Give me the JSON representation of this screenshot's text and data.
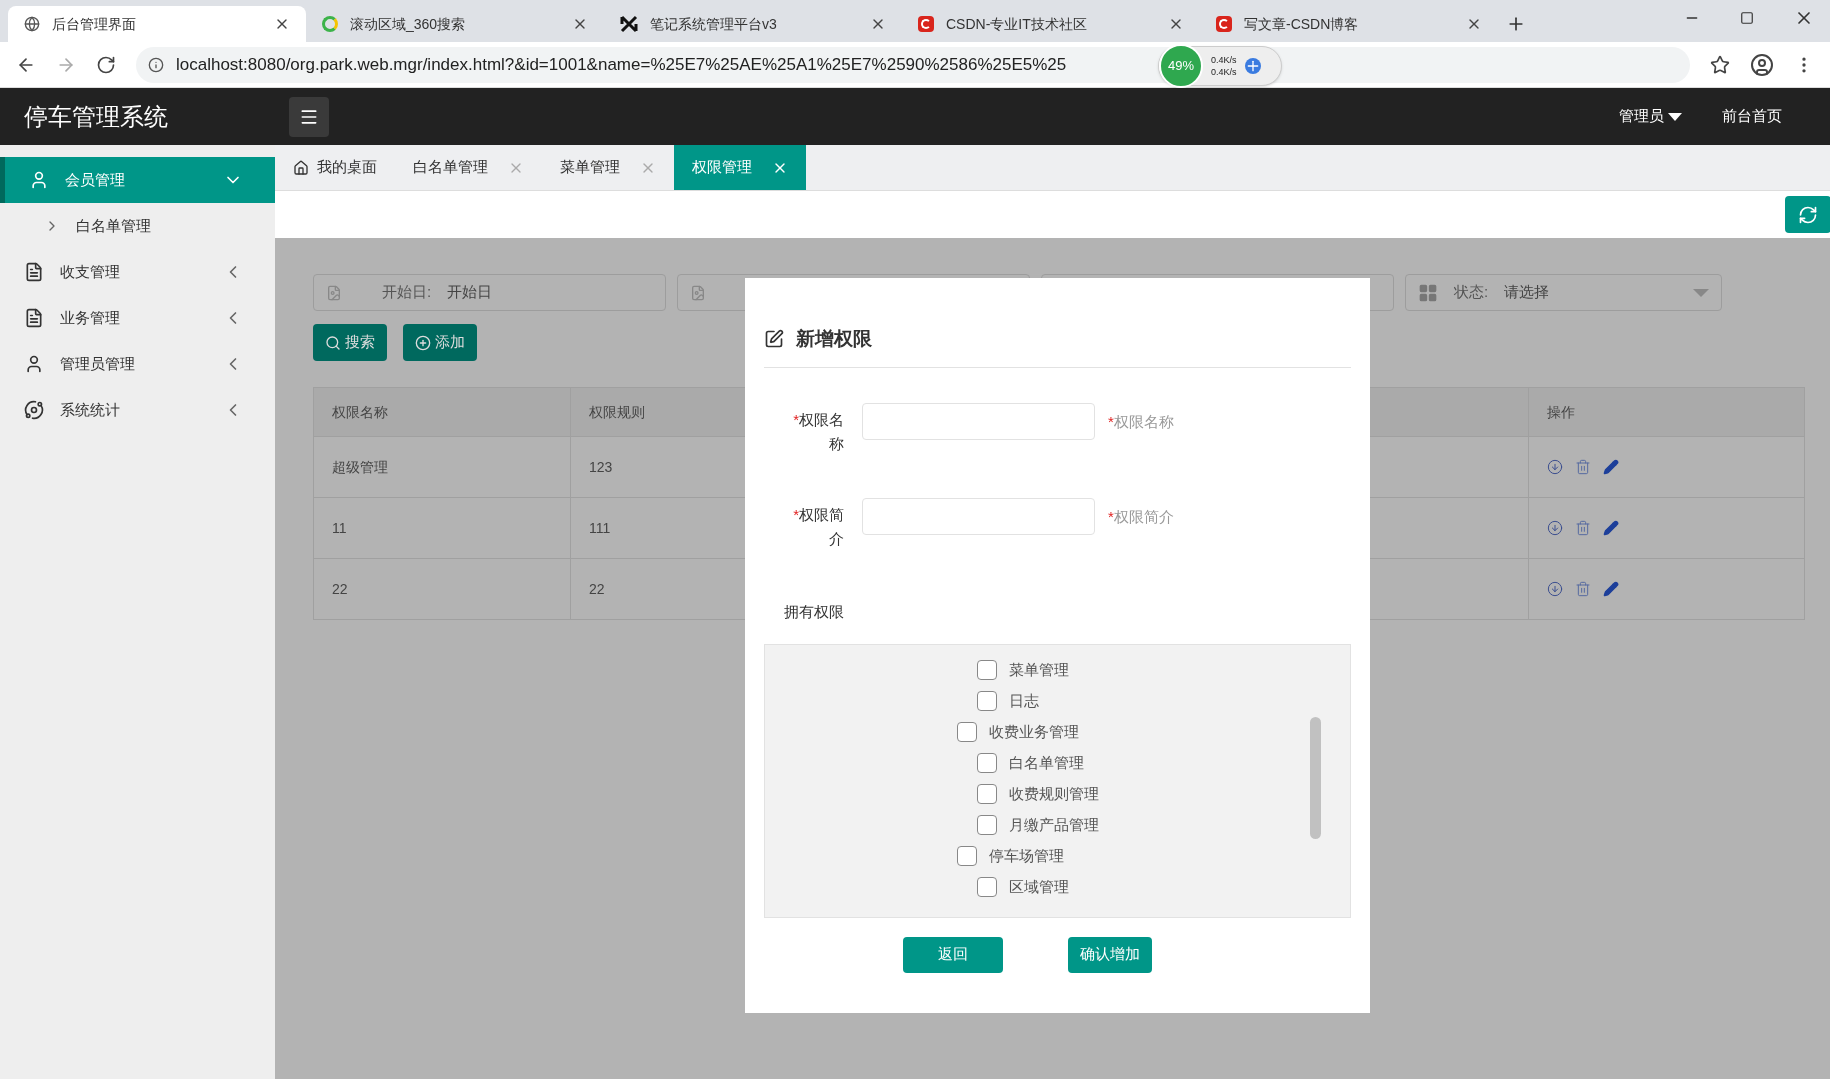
{
  "browser": {
    "tabs": [
      {
        "title": "后台管理界面",
        "selected": true
      },
      {
        "title": "滚动区域_360搜索",
        "selected": false
      },
      {
        "title": "笔记系统管理平台v3",
        "selected": false
      },
      {
        "title": "CSDN-专业IT技术社区",
        "selected": false
      },
      {
        "title": "写文章-CSDN博客",
        "selected": false
      }
    ],
    "url": "localhost:8080/org.park.web.mgr/index.html?&id=1001&name=%25E7%25AE%25A1%25E7%2590%2586%25E5%25",
    "speed": {
      "percent": "49%",
      "up": "0.4K/s",
      "down": "0.4K/s"
    }
  },
  "header": {
    "title": "停车管理系统",
    "user_menu": "管理员",
    "home_link": "前台首页"
  },
  "sidebar": {
    "items": [
      {
        "label": "会员管理",
        "selected": true,
        "expanded": true,
        "children": [
          {
            "label": "白名单管理"
          }
        ]
      },
      {
        "label": "收支管理",
        "selected": false,
        "expanded": false
      },
      {
        "label": "业务管理",
        "selected": false,
        "expanded": false
      },
      {
        "label": "管理员管理",
        "selected": false,
        "expanded": false
      },
      {
        "label": "系统统计",
        "selected": false,
        "expanded": false
      }
    ]
  },
  "page_tabs": [
    {
      "label": "我的桌面",
      "selected": false,
      "closable": false
    },
    {
      "label": "白名单管理",
      "selected": false,
      "closable": true
    },
    {
      "label": "菜单管理",
      "selected": false,
      "closable": true
    },
    {
      "label": "权限管理",
      "selected": true,
      "closable": true
    }
  ],
  "filters": [
    {
      "kind": "date",
      "label": "开始日:",
      "value": "开始日"
    },
    {
      "kind": "date"
    },
    {
      "kind": "text"
    },
    {
      "kind": "select",
      "label": "状态:",
      "value": "请选择"
    }
  ],
  "actions": [
    "搜索",
    "添加"
  ],
  "table": {
    "columns": [
      "权限名称",
      "权限规则",
      "",
      "操作"
    ],
    "rows": [
      [
        "超级管理",
        "123"
      ],
      [
        "11",
        "111"
      ],
      [
        "22",
        "22"
      ]
    ]
  },
  "dialog": {
    "title": "新增权限",
    "fields": [
      {
        "label": "权限名称",
        "hint": "权限名称",
        "mark": "*",
        "hint_mark": "*"
      },
      {
        "label": "权限简介",
        "hint": "权限简介",
        "mark": "*",
        "hint_mark": "*"
      }
    ],
    "permissions_label": "拥有权限",
    "permissions": [
      {
        "children": [
          {
            "label": "菜单管理",
            "checked": false
          },
          {
            "label": "日志",
            "checked": false
          }
        ]
      },
      {
        "label": "收费业务管理",
        "checked": false,
        "children": [
          {
            "label": "白名单管理",
            "checked": false
          },
          {
            "label": "收费规则管理",
            "checked": false
          },
          {
            "label": "月缴产品管理",
            "checked": false
          }
        ]
      },
      {
        "label": "停车场管理",
        "checked": false,
        "children": [
          {
            "label": "区域管理",
            "checked": false
          }
        ]
      }
    ],
    "buttons": [
      "返回",
      "确认增加"
    ]
  }
}
